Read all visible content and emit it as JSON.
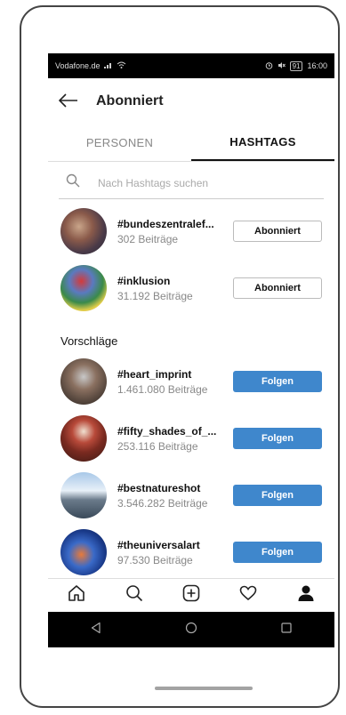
{
  "status_bar": {
    "carrier": "Vodafone.de",
    "battery": "91",
    "time": "16:00"
  },
  "header": {
    "title": "Abonniert"
  },
  "tabs": [
    {
      "label": "PERSONEN",
      "active": false
    },
    {
      "label": "HASHTAGS",
      "active": true
    }
  ],
  "search": {
    "placeholder": "Nach Hashtags suchen"
  },
  "followed": [
    {
      "tag": "#bundeszentralef...",
      "posts": "302 Beiträge",
      "button": "Abonniert"
    },
    {
      "tag": "#inklusion",
      "posts": "31.192 Beiträge",
      "button": "Abonniert"
    }
  ],
  "suggestions_title": "Vorschläge",
  "suggestions": [
    {
      "tag": "#heart_imprint",
      "posts": "1.461.080 Beiträge",
      "button": "Folgen"
    },
    {
      "tag": "#fifty_shades_of_...",
      "posts": "253.116 Beiträge",
      "button": "Folgen"
    },
    {
      "tag": "#bestnatureshot",
      "posts": "3.546.282 Beiträge",
      "button": "Folgen"
    },
    {
      "tag": "#theuniversalart",
      "posts": "97.530 Beiträge",
      "button": "Folgen"
    }
  ],
  "colors": {
    "follow_button": "#3f87cc"
  },
  "icons": {
    "bottom_nav": [
      "home-icon",
      "search-icon",
      "add-post-icon",
      "heart-icon",
      "profile-icon"
    ],
    "android_nav": [
      "back-triangle-icon",
      "home-circle-icon",
      "recents-square-icon"
    ]
  }
}
